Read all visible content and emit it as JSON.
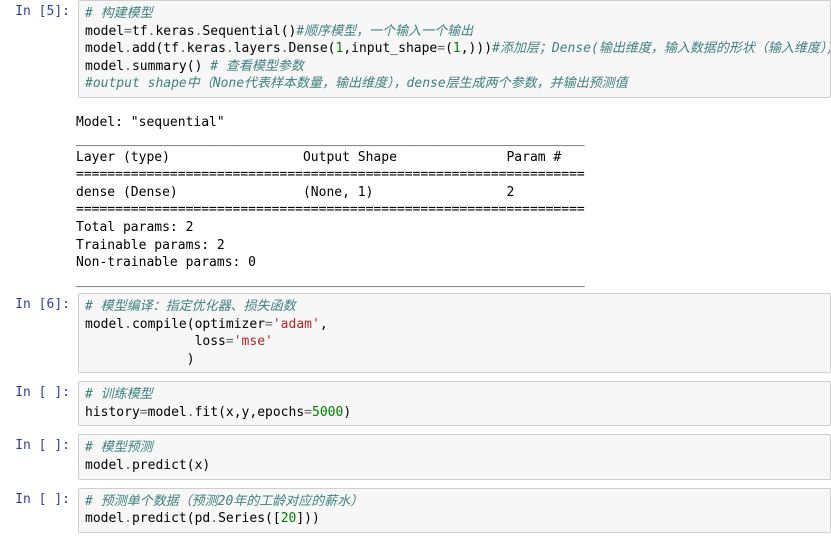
{
  "cells": {
    "c5": {
      "prompt": "In  [5]:",
      "comment1": "# 构建模型",
      "l2a": "model",
      "l2b": "=",
      "l2c": "tf",
      "l2d": ".",
      "l2e": "keras",
      "l2f": ".",
      "l2g": "Sequential()",
      "l2cm": "#顺序模型，一个输入一个输出",
      "l3a": "model",
      "l3b": ".",
      "l3c": "add(tf",
      "l3d": ".",
      "l3e": "keras",
      "l3f": ".",
      "l3g": "layers",
      "l3h": ".",
      "l3i": "Dense(",
      "l3num1": "1",
      "l3j": ",input_shape",
      "l3k": "=",
      "l3l": "(",
      "l3num2": "1",
      "l3m": ",)))",
      "l3cm": "#添加层；Dense(输出维度，输入数据的形状（输入维度）)",
      "l4a": "model",
      "l4b": ".",
      "l4c": "summary() ",
      "l4cm": "# 查看模型参数",
      "l5cm": "#output shape中（None代表样本数量，输出维度），dense层生成两个参数，并输出预测值"
    },
    "out5": {
      "l1": "Model: \"sequential\"",
      "sep": "_________________________________________________________________",
      "hdr": "Layer (type)                 Output Shape              Param #   ",
      "sep2": "=================================================================",
      "row": "dense (Dense)                (None, 1)                 2         ",
      "tp": "Total params: 2",
      "trp": "Trainable params: 2",
      "ntp": "Non-trainable params: 0"
    },
    "c6": {
      "prompt": "In  [6]:",
      "cm1": "# 模型编译：指定优化器、损失函数",
      "l2a": "model",
      "l2b": ".",
      "l2c": "compile(optimizer",
      "l2d": "=",
      "l2e": "'adam'",
      "l2f": ",",
      "l3pad": "              loss",
      "l3eq": "=",
      "l3str": "'mse'",
      "l4pad": "             )"
    },
    "c7": {
      "prompt": "In  [ ]:",
      "cm1": "# 训练模型",
      "l2a": "history",
      "l2b": "=",
      "l2c": "model",
      "l2d": ".",
      "l2e": "fit(x,y,epochs",
      "l2f": "=",
      "l2num": "5000",
      "l2g": ")"
    },
    "c8": {
      "prompt": "In  [ ]:",
      "cm1": "# 模型预测",
      "l2a": "model",
      "l2b": ".",
      "l2c": "predict(x)"
    },
    "c9": {
      "prompt": "In  [ ]:",
      "cm1": "# 预测单个数据（预测20年的工龄对应的薪水）",
      "l2a": "model",
      "l2b": ".",
      "l2c": "predict(pd",
      "l2d": ".",
      "l2e": "Series([",
      "l2num": "20",
      "l2f": "]))"
    }
  }
}
